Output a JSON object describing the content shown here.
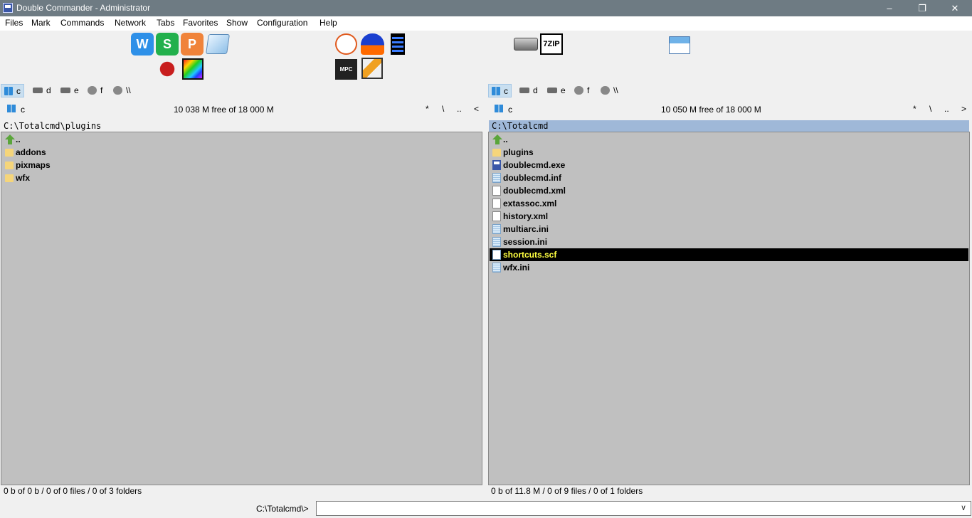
{
  "window": {
    "title": "Double Commander - Administrator",
    "minimize": "–",
    "restore": "❐",
    "close": "✕"
  },
  "menu": [
    "Files",
    "Mark",
    "Commands",
    "Network",
    "Tabs",
    "Favorites",
    "Show",
    "Configuration",
    "Help"
  ],
  "toolbar": {
    "w_label": "W",
    "s_label": "S",
    "p_label": "P",
    "zip_label": "7ZIP",
    "mpc_label": "MPC BE",
    "colors": {
      "wps_writer": "#2e90e8",
      "wps_sheet": "#22b04c",
      "wps_presentation": "#f0833a"
    }
  },
  "left": {
    "drives": [
      "c",
      "d",
      "e",
      "f",
      "\\\\"
    ],
    "info": {
      "drive": "c",
      "free": "10 038 M  free of  18 000 M",
      "nav": [
        "*",
        "\\",
        "..",
        "<"
      ]
    },
    "path": "C:\\Totalcmd\\plugins",
    "files": [
      {
        "name": "..",
        "icon": "up-icon"
      },
      {
        "name": "addons",
        "icon": "folder-icon"
      },
      {
        "name": "pixmaps",
        "icon": "folder-icon"
      },
      {
        "name": "wfx",
        "icon": "folder-icon"
      }
    ],
    "status": "0 b of 0 b  /  0 of 0 files  /  0 of 3 folders"
  },
  "right": {
    "drives": [
      "c",
      "d",
      "e",
      "f",
      "\\\\"
    ],
    "info": {
      "drive": "c",
      "free": "10 050 M  free of  18 000 M",
      "nav": [
        "*",
        "\\",
        "..",
        ">"
      ]
    },
    "path": "C:\\Totalcmd",
    "files": [
      {
        "name": "..",
        "icon": "up-icon"
      },
      {
        "name": "plugins",
        "icon": "folder-icon"
      },
      {
        "name": "doublecmd.exe",
        "icon": "exe-icon"
      },
      {
        "name": "doublecmd.inf",
        "icon": "ini-icon"
      },
      {
        "name": "doublecmd.xml",
        "icon": "xml-icon"
      },
      {
        "name": "extassoc.xml",
        "icon": "xml-icon"
      },
      {
        "name": "history.xml",
        "icon": "xml-icon"
      },
      {
        "name": "multiarc.ini",
        "icon": "ini-icon"
      },
      {
        "name": "session.ini",
        "icon": "ini-icon"
      },
      {
        "name": "shortcuts.scf",
        "icon": "file-icon",
        "selected": true
      },
      {
        "name": "wfx.ini",
        "icon": "ini-icon"
      }
    ],
    "status": "0 b of 11.8 M  /  0 of 9 files  /  0 of 1 folders"
  },
  "command": {
    "label": "C:\\Totalcmd\\>",
    "value": ""
  }
}
